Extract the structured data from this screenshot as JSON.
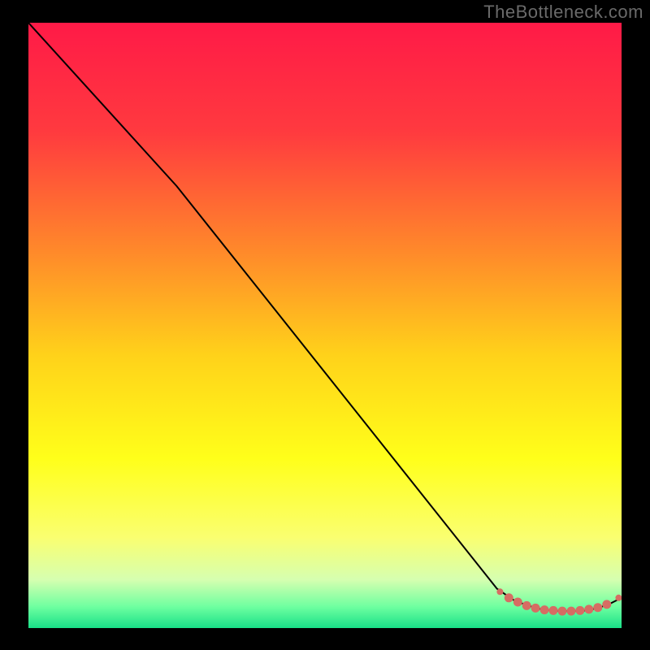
{
  "watermark": "TheBottleneck.com",
  "colors": {
    "bg": "#000000",
    "watermark": "#6a6a6a",
    "curve": "#000000",
    "marker_fill": "#d66d63",
    "marker_stroke": "#b84f47"
  },
  "chart_data": {
    "type": "line",
    "title": "",
    "xlabel": "",
    "ylabel": "",
    "xlim": [
      0,
      100
    ],
    "ylim": [
      0,
      100
    ],
    "grid": false,
    "series": [
      {
        "name": "bottleneck-curve",
        "x": [
          0,
          25,
          79,
          82,
          84,
          86,
          88,
          90,
          92,
          94,
          96,
          98,
          100
        ],
        "y": [
          100,
          73,
          6.5,
          4.5,
          3.8,
          3.2,
          2.9,
          2.8,
          2.8,
          2.9,
          3.3,
          4.0,
          5.0
        ]
      }
    ],
    "markers": {
      "name": "highlight-points",
      "x": [
        79.5,
        81,
        82.5,
        84,
        85.5,
        87,
        88.5,
        90,
        91.5,
        93,
        94.5,
        96,
        97.5,
        99.5
      ],
      "y": [
        6.0,
        5.0,
        4.3,
        3.7,
        3.3,
        3.0,
        2.9,
        2.8,
        2.8,
        2.9,
        3.1,
        3.4,
        3.9,
        5.0
      ]
    },
    "gradient_stops": [
      {
        "pos": 0.0,
        "color": "#ff1a47"
      },
      {
        "pos": 0.18,
        "color": "#ff3a3f"
      },
      {
        "pos": 0.38,
        "color": "#ff8a2a"
      },
      {
        "pos": 0.55,
        "color": "#ffd21a"
      },
      {
        "pos": 0.72,
        "color": "#ffff1a"
      },
      {
        "pos": 0.85,
        "color": "#faff70"
      },
      {
        "pos": 0.92,
        "color": "#d6ffb0"
      },
      {
        "pos": 0.965,
        "color": "#6effa0"
      },
      {
        "pos": 1.0,
        "color": "#18e088"
      }
    ]
  }
}
